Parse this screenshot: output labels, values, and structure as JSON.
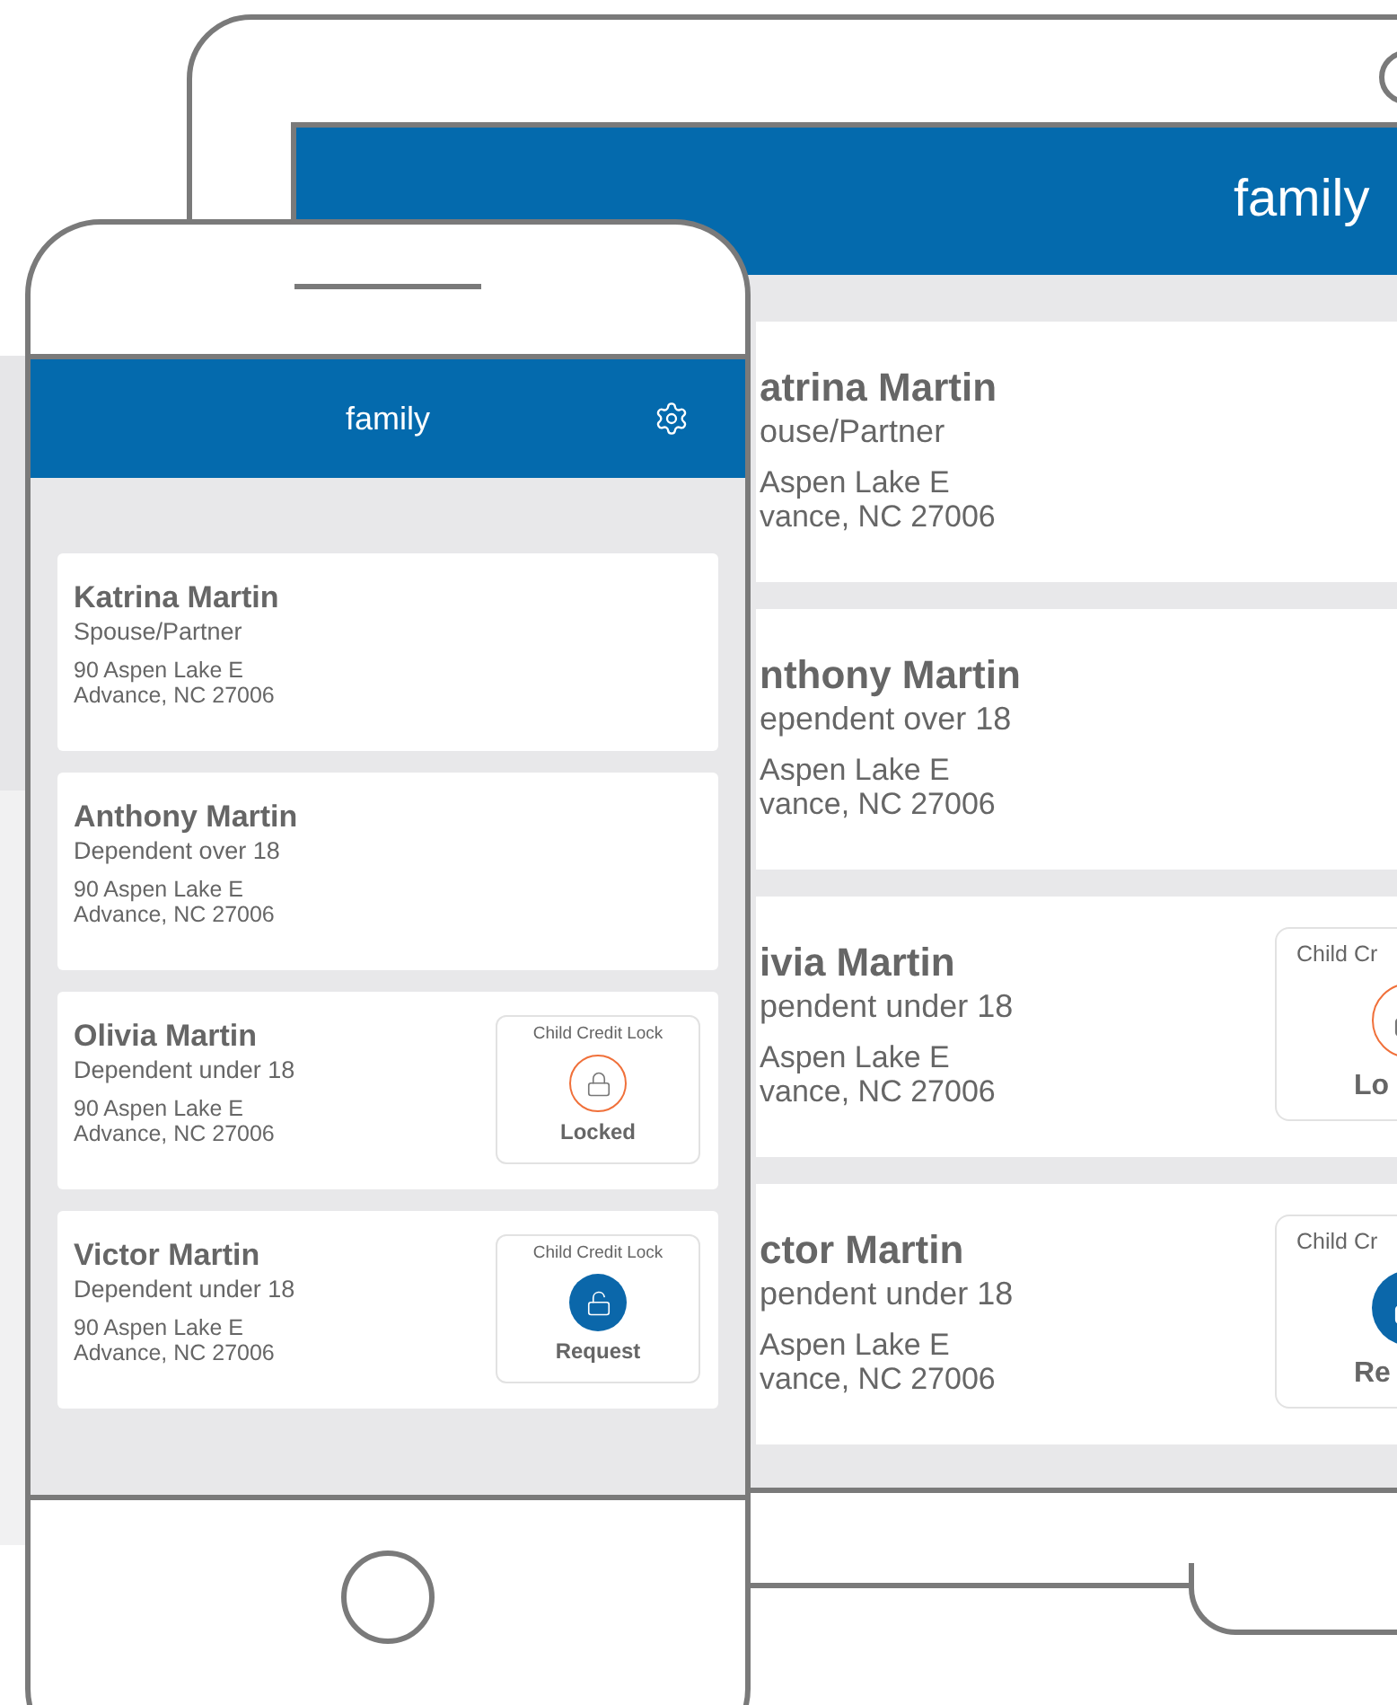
{
  "tablet": {
    "title": "family",
    "members": [
      {
        "name": "atrina Martin",
        "relation": "ouse/Partner",
        "address": [
          "Aspen Lake E",
          "vance, NC 27006"
        ]
      },
      {
        "name": "nthony Martin",
        "relation": "ependent over 18",
        "address": [
          "Aspen Lake E",
          "vance, NC 27006"
        ]
      },
      {
        "name": "ivia Martin",
        "relation": "pendent under 18",
        "address": [
          "Aspen Lake E",
          "vance, NC 27006"
        ],
        "lock": {
          "label": "Child Cr",
          "kind": "locked",
          "status": "Lo"
        }
      },
      {
        "name": "ctor Martin",
        "relation": "pendent under 18",
        "address": [
          "Aspen Lake E",
          "vance, NC 27006"
        ],
        "lock": {
          "label": "Child Cr",
          "kind": "request",
          "status": "Re"
        }
      }
    ]
  },
  "phone": {
    "title": "family",
    "members": [
      {
        "name": "Katrina Martin",
        "relation": "Spouse/Partner",
        "address": [
          "90 Aspen Lake E",
          "Advance, NC 27006"
        ]
      },
      {
        "name": "Anthony Martin",
        "relation": "Dependent over 18",
        "address": [
          "90 Aspen Lake E",
          "Advance, NC 27006"
        ]
      },
      {
        "name": "Olivia Martin",
        "relation": "Dependent under 18",
        "address": [
          "90 Aspen Lake E",
          "Advance, NC 27006"
        ],
        "lock": {
          "label": "Child Credit Lock",
          "kind": "locked",
          "status": "Locked"
        }
      },
      {
        "name": "Victor Martin",
        "relation": "Dependent under 18",
        "address": [
          "90 Aspen Lake E",
          "Advance, NC 27006"
        ],
        "lock": {
          "label": "Child Credit Lock",
          "kind": "request",
          "status": "Request"
        }
      }
    ]
  }
}
